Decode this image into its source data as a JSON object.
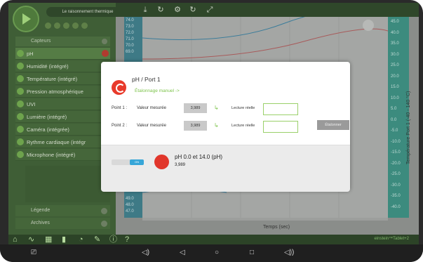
{
  "app": {
    "experiment_title": "Le raisonnement thermique"
  },
  "sidebar": {
    "header": "Capteurs",
    "items": [
      {
        "label": "pH",
        "active": true
      },
      {
        "label": "Humidité (intégré)"
      },
      {
        "label": "Température (intégré)"
      },
      {
        "label": "Pression atmosphérique"
      },
      {
        "label": "UVI"
      },
      {
        "label": "Lumière (intégré)"
      },
      {
        "label": "Caméra (intégrée)"
      },
      {
        "label": "Rythme cardiaque (intégr"
      },
      {
        "label": "Microphone (intégré)"
      }
    ],
    "legend_label": "Légende",
    "archives_label": "Archives"
  },
  "graph": {
    "left_ticks": [
      "74.0",
      "73.0",
      "72.0",
      "71.0",
      "70.0",
      "69.0"
    ],
    "left_bottom_ticks": [
      "49.0",
      "48.0",
      "47.0"
    ],
    "right_ticks": [
      "45.0",
      "40.0",
      "35.0",
      "30.0",
      "25.0",
      "20.0",
      "15.0",
      "10.0",
      "5.0",
      "0.0",
      "-5.0",
      "-10.0",
      "-15.0",
      "-20.0",
      "-25.0",
      "-30.0",
      "-35.0",
      "-40.0"
    ],
    "right_axis_label": "Température Port 1 (-40 - 140 °C)",
    "x_label": "Temps (sec)"
  },
  "modal": {
    "title": "pH / Port 1",
    "subtitle": "Étalonnage manuel ->",
    "points": [
      {
        "label": "Point 1 :",
        "measured_label": "Valeur mesurée",
        "value": "3,989",
        "real_label": "Lecture réelle",
        "input": ""
      },
      {
        "label": "Point 2 :",
        "measured_label": "Valeur mesurée",
        "value": "3,989",
        "real_label": "Lecture réelle",
        "input": ""
      }
    ],
    "calibrate_label": "Étalonner",
    "toggle_label": "ON",
    "range_text": "pH 0.0 et 14.0 (pH)",
    "current_value": "3,989"
  },
  "bottombar": {
    "brand": "einstein™Tablet+2"
  },
  "colors": {
    "accent_green": "#7cc34a",
    "sensor_red": "#e1362b",
    "toggle_blue": "#37a6d8"
  }
}
